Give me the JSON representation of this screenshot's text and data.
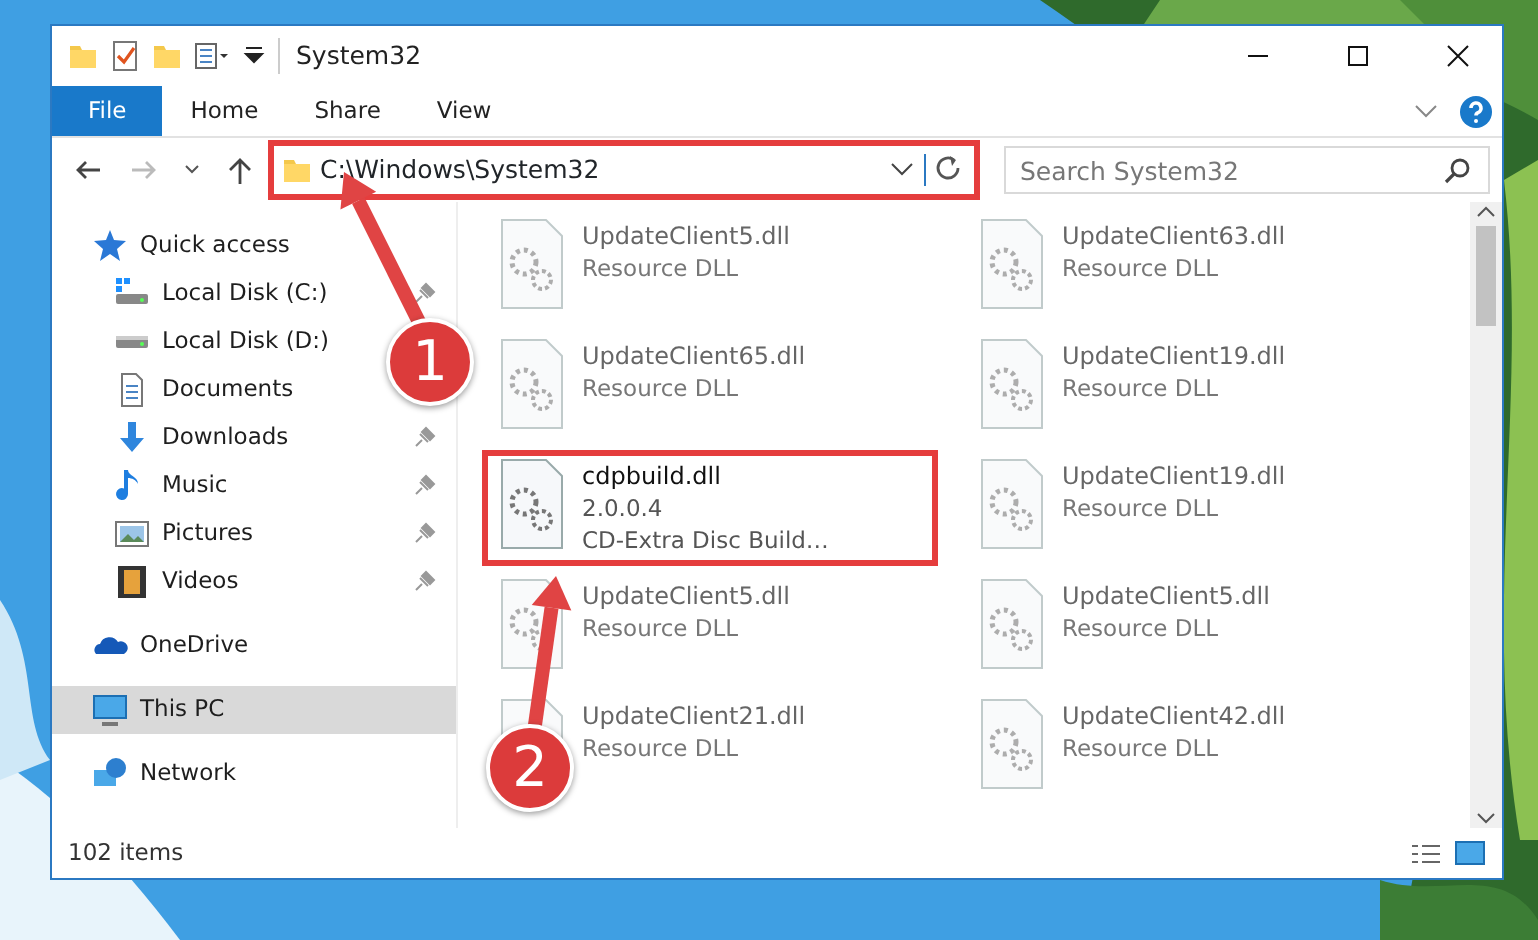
{
  "window": {
    "title": "System32"
  },
  "ribbon": {
    "tabs": [
      {
        "label": "File",
        "kind": "file"
      },
      {
        "label": "Home",
        "kind": "tab"
      },
      {
        "label": "Share",
        "kind": "tab"
      },
      {
        "label": "View",
        "kind": "tab"
      }
    ]
  },
  "address": {
    "path": "C:\\Windows\\System32",
    "highlighted": true
  },
  "search": {
    "placeholder": "Search System32"
  },
  "sidebar": {
    "items": [
      {
        "label": "Quick access",
        "selected": false,
        "children": [
          {
            "label": "Local Disk (C:)",
            "pinned": true
          },
          {
            "label": "Local Disk (D:)",
            "pinned": false
          },
          {
            "label": "Documents",
            "pinned": false
          },
          {
            "label": "Downloads",
            "pinned": true
          },
          {
            "label": "Music",
            "pinned": true
          },
          {
            "label": "Pictures",
            "pinned": true
          },
          {
            "label": "Videos",
            "pinned": true
          }
        ]
      },
      {
        "label": "OneDrive",
        "selected": false
      },
      {
        "label": "This PC",
        "selected": true
      },
      {
        "label": "Network",
        "selected": false
      }
    ]
  },
  "files": [
    {
      "name": "UpdateClient5.dll",
      "details": [
        "Resource DLL"
      ],
      "blurred": true,
      "highlighted": false
    },
    {
      "name": "UpdateClient63.dll",
      "details": [
        "Resource DLL"
      ],
      "blurred": true,
      "highlighted": false
    },
    {
      "name": "UpdateClient65.dll",
      "details": [
        "Resource DLL"
      ],
      "blurred": true,
      "highlighted": false
    },
    {
      "name": "UpdateClient19.dll",
      "details": [
        "Resource DLL"
      ],
      "blurred": true,
      "highlighted": false
    },
    {
      "name": "cdpbuild.dll",
      "details": [
        "2.0.0.4",
        "CD-Extra Disc Build…"
      ],
      "blurred": false,
      "highlighted": true
    },
    {
      "name": "UpdateClient19.dll",
      "details": [
        "Resource DLL"
      ],
      "blurred": true,
      "highlighted": false
    },
    {
      "name": "UpdateClient5.dll",
      "details": [
        "Resource DLL"
      ],
      "blurred": true,
      "highlighted": false
    },
    {
      "name": "UpdateClient5.dll",
      "details": [
        "Resource DLL"
      ],
      "blurred": true,
      "highlighted": false
    },
    {
      "name": "UpdateClient21.dll",
      "details": [
        "Resource DLL"
      ],
      "blurred": true,
      "highlighted": false
    },
    {
      "name": "UpdateClient42.dll",
      "details": [
        "Resource DLL"
      ],
      "blurred": true,
      "highlighted": false
    }
  ],
  "status_bar": {
    "text": "102 items"
  },
  "annotations": [
    {
      "label": "1"
    },
    {
      "label": "2"
    }
  ]
}
